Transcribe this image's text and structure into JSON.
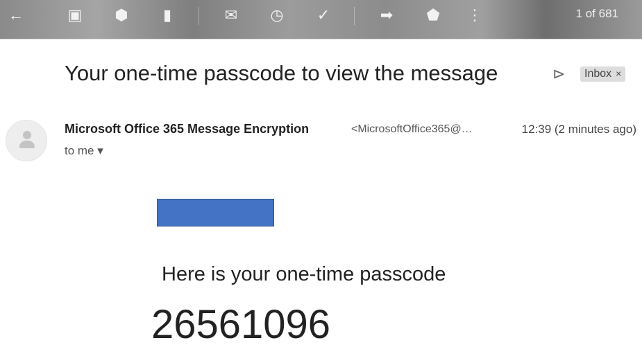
{
  "toolbar": {
    "icons": [
      "back-arrow",
      "archive",
      "report-spam",
      "delete",
      "mark-unread",
      "snooze",
      "add-to-tasks",
      "move-to",
      "labels",
      "more"
    ],
    "count": "1 of 681"
  },
  "message": {
    "subject": "Your one-time passcode to view the message",
    "label": "Inbox",
    "label_close": "×",
    "sender": "Microsoft Office 365 Message Encryption",
    "sender_email": "<MicrosoftOffice365@…",
    "time": "12:39 (2 minutes ago)",
    "recipient": "to me ▾",
    "redaction_color": "#4472c4"
  },
  "body": {
    "intro": "Here is your one-time passcode",
    "passcode": "26561096"
  }
}
